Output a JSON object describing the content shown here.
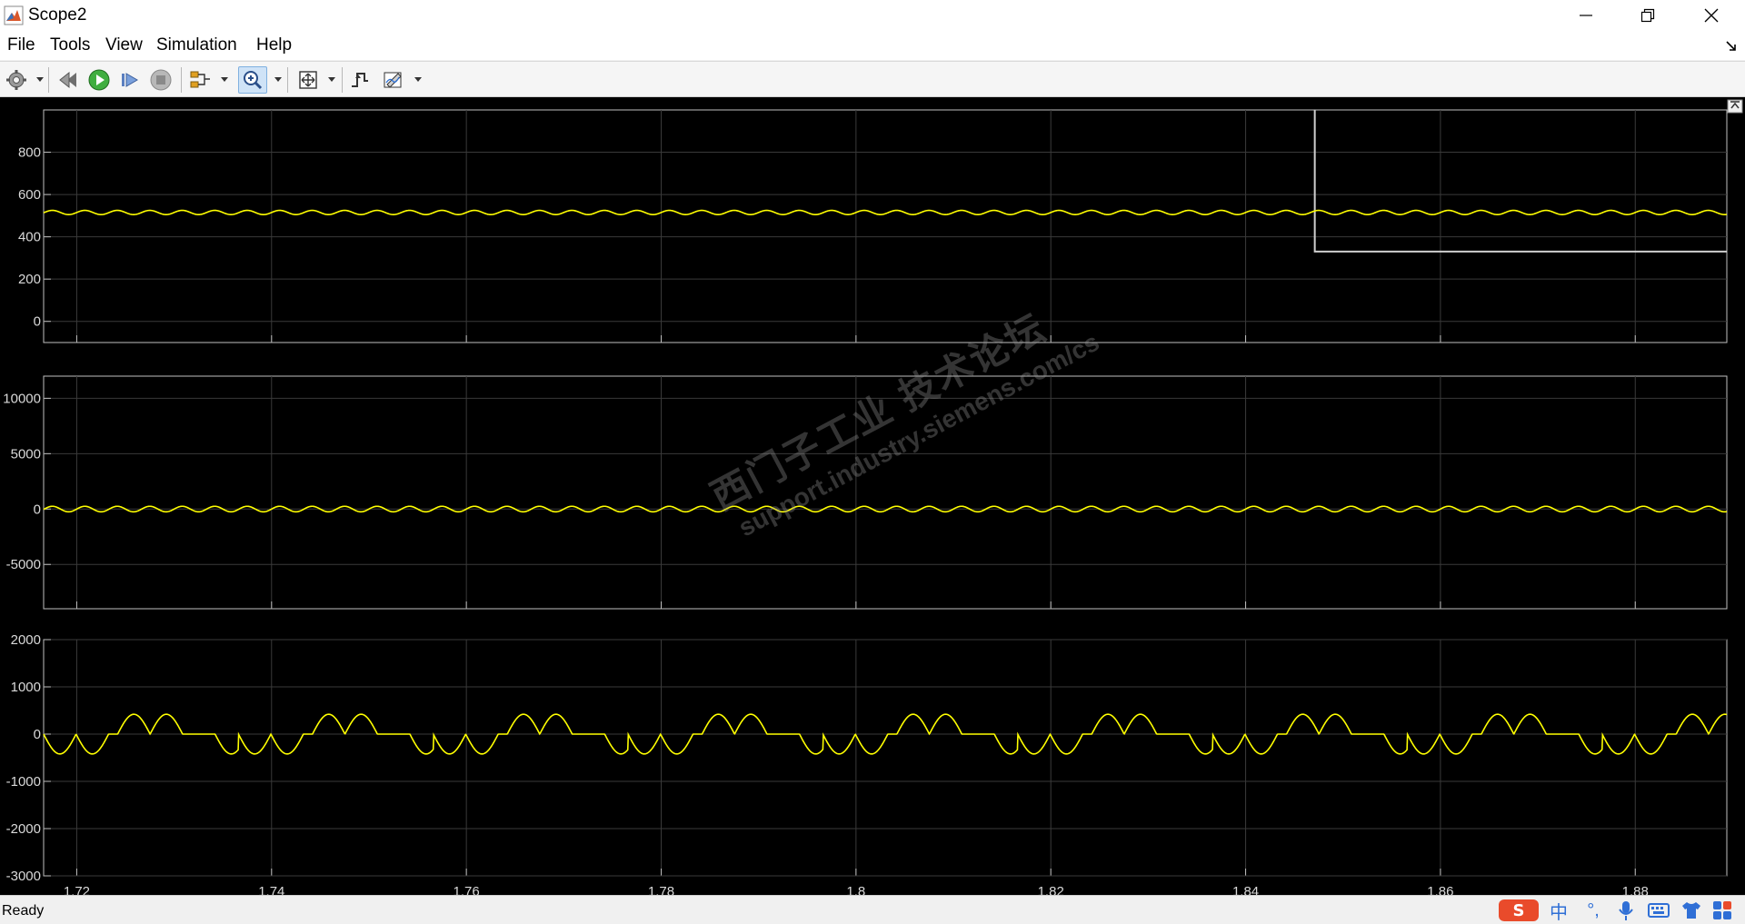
{
  "window": {
    "title": "Scope2",
    "minimize_icon": "minimize-icon",
    "restore_icon": "restore-icon",
    "close_icon": "close-icon"
  },
  "menu": {
    "items": [
      "File",
      "Tools",
      "View",
      "Simulation",
      "Help"
    ]
  },
  "toolbar": {
    "icons": [
      "gear-icon",
      "rewind-icon",
      "run-icon",
      "step-forward-icon",
      "stop-icon",
      "signal-select-icon",
      "zoom-icon",
      "fit-axes-icon",
      "triggers-icon",
      "measure-icon"
    ]
  },
  "status": {
    "text": "Ready"
  },
  "ime": {
    "lang": "中",
    "punct": "°,"
  },
  "watermark": {
    "line1": "西门子工业  技术论坛",
    "line2": "support.industry.siemens.com/cs"
  },
  "colors": {
    "plot_bg": "#000000",
    "grid": "#3a3a3a",
    "axes": "#bfbfbf",
    "trace": "#ffff00",
    "tick_text": "#d9d9d9"
  },
  "chart_data": [
    {
      "type": "line",
      "xlim": [
        1.7166,
        1.8894
      ],
      "ylim": [
        -100,
        1000
      ],
      "yticks": [
        0,
        200,
        400,
        600,
        800
      ],
      "ytick_labels": [
        "0",
        "200",
        "400",
        "600",
        "800"
      ],
      "xticks": [
        1.72,
        1.74,
        1.76,
        1.78,
        1.8,
        1.82,
        1.84,
        1.86,
        1.88
      ],
      "grid": true,
      "series": [
        {
          "kind": "ripple",
          "offset": 515,
          "amplitude": 10,
          "frequency_hz": 300
        }
      ],
      "marker": {
        "x": 1.8471,
        "y_top": 1000,
        "y_bottom": 330
      }
    },
    {
      "type": "line",
      "xlim": [
        1.7166,
        1.8894
      ],
      "ylim": [
        -9000,
        12000
      ],
      "yticks": [
        -5000,
        0,
        5000,
        10000
      ],
      "ytick_labels": [
        "-5000",
        "0",
        "5000",
        "10000"
      ],
      "xticks": [
        1.72,
        1.74,
        1.76,
        1.78,
        1.8,
        1.82,
        1.84,
        1.86,
        1.88
      ],
      "grid": true,
      "series": [
        {
          "kind": "ripple",
          "offset": 0,
          "amplitude": 250,
          "frequency_hz": 300
        }
      ]
    },
    {
      "type": "line",
      "xlim": [
        1.7166,
        1.8894
      ],
      "ylim": [
        -3000,
        2000
      ],
      "yticks": [
        -3000,
        -2000,
        -1000,
        0,
        1000,
        2000
      ],
      "ytick_labels": [
        "-3000",
        "-2000",
        "-1000",
        "0",
        "1000",
        "2000"
      ],
      "xticks": [
        1.72,
        1.74,
        1.76,
        1.78,
        1.8,
        1.82,
        1.84,
        1.86,
        1.88
      ],
      "xtick_labels": [
        "1.72",
        "1.74",
        "1.76",
        "1.78",
        "1.8",
        "1.82",
        "1.84",
        "1.86",
        "1.88"
      ],
      "grid": true,
      "series": [
        {
          "kind": "pulse_bursts",
          "x0": 1.7166,
          "period_s": 0.02,
          "amplitude": 420,
          "lobe_hz": 300
        }
      ]
    }
  ]
}
